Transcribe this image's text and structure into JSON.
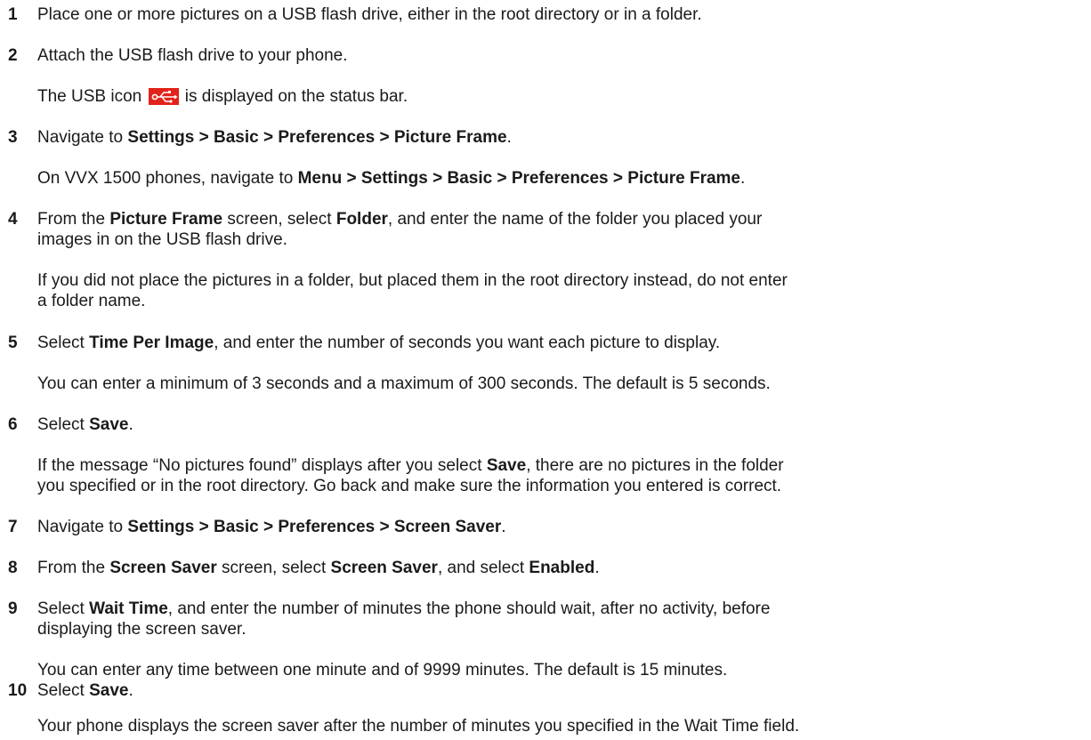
{
  "steps": [
    {
      "number": "1",
      "main": "Place one or more pictures on a USB flash drive, either in the root directory or in a folder."
    },
    {
      "number": "2",
      "main": "Attach the USB flash drive to your phone.",
      "note_before_icon": "The USB icon",
      "note_icon": "usb-icon",
      "note_after_icon": "is displayed on the status bar."
    },
    {
      "number": "3",
      "main_prefix": "Navigate to",
      "main_bold": "Settings > Basic > Preferences > Picture Frame",
      "main_suffix": ".",
      "note_prefix": "On VVX 1500 phones, navigate to",
      "note_bold": "Menu > Settings > Basic > Preferences > Picture Frame",
      "note_suffix": "."
    },
    {
      "number": "4",
      "main_p1": "From the",
      "main_b1": "Picture Frame",
      "main_p2": "screen, select",
      "main_b2": "Folder",
      "main_p3": ", and enter the name of the folder you placed your",
      "main_line2": "images in on the USB flash drive.",
      "note_line1": "If you did not place the pictures in a folder, but placed them in the root directory instead, do not enter",
      "note_line2": "a folder name."
    },
    {
      "number": "5",
      "main_prefix": "Select",
      "main_bold": "Time Per Image",
      "main_suffix": ", and enter the number of seconds you want each picture to display.",
      "note": "You can enter a minimum of 3 seconds and a maximum of 300 seconds. The default is 5 seconds."
    },
    {
      "number": "6",
      "main_prefix": "Select",
      "main_bold": "Save",
      "main_suffix": ".",
      "note_p1": "If the message “No pictures found” displays after you select",
      "note_b1": "Save",
      "note_p2": ", there are no pictures in the folder",
      "note_line2": "you specified or in the root directory. Go back and make sure the information you entered is correct."
    },
    {
      "number": "7",
      "main_prefix": "Navigate to",
      "main_bold": "Settings > Basic > Preferences > Screen Saver",
      "main_suffix": "."
    },
    {
      "number": "8",
      "main_p1": "From the",
      "main_b1": "Screen Saver",
      "main_p2": "screen, select",
      "main_b2": "Screen Saver",
      "main_p3": ", and select",
      "main_b3": "Enabled",
      "main_p4": "."
    },
    {
      "number": "9",
      "main_prefix": "Select",
      "main_bold": "Wait Time",
      "main_suffix": ", and enter the number of minutes the phone should wait, after no activity, before",
      "main_line2": "displaying the screen saver.",
      "note": "You can enter any time between one minute and of 9999 minutes. The default is 15 minutes."
    },
    {
      "number": "10",
      "main_prefix": "Select",
      "main_bold": "Save",
      "main_suffix": ".",
      "note": "Your phone displays the screen saver after the number of minutes you specified in the Wait Time field."
    }
  ],
  "colors": {
    "text": "#1a1a1a",
    "usb_icon_bg": "#e2231a"
  }
}
